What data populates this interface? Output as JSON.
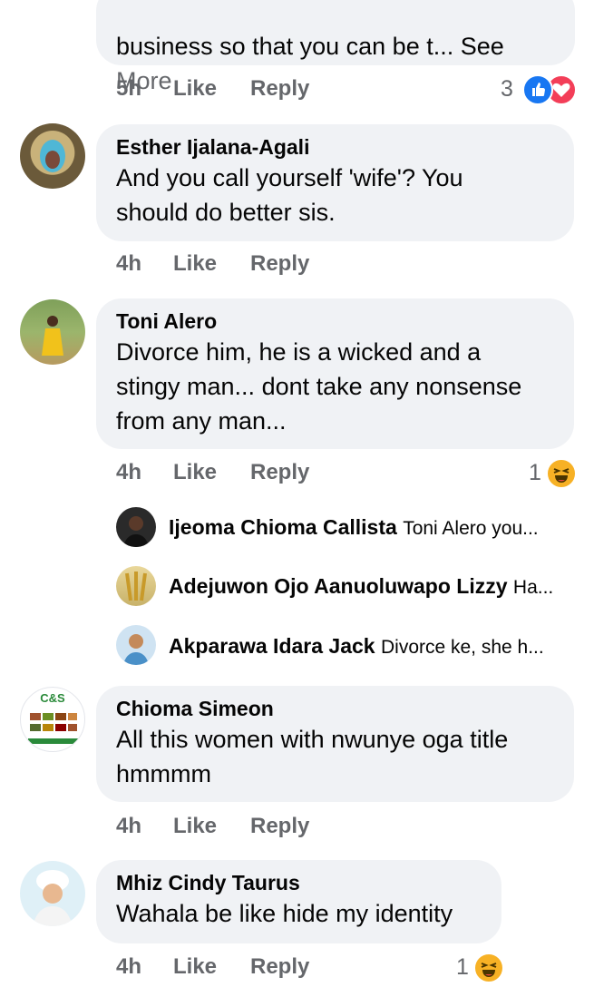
{
  "comments": [
    {
      "text_top": "business so that you can be t... See",
      "text_more": "More",
      "time": "5h",
      "like": "Like",
      "reply": "Reply",
      "reactions": "3"
    },
    {
      "author": "Esther Ijalana-Agali",
      "text": "And you call yourself 'wife'? You\nshould do better sis.",
      "time": "4h",
      "like": "Like",
      "reply": "Reply"
    },
    {
      "author": "Toni Alero",
      "text": "Divorce him, he is a wicked and a\nstingy man... dont take any nonsense\nfrom any man...",
      "time": "4h",
      "like": "Like",
      "reply": "Reply",
      "reactions": "1"
    },
    {
      "author": "Chioma Simeon",
      "avatar_text": "C&S",
      "text": "All this women with nwunye oga title\nhmmmm",
      "time": "4h",
      "like": "Like",
      "reply": "Reply"
    },
    {
      "author": "Mhiz Cindy Taurus",
      "text": "Wahala be like hide my identity",
      "time": "4h",
      "like": "Like",
      "reply": "Reply",
      "reactions": "1"
    }
  ],
  "replies": [
    {
      "name": "Ijeoma Chioma Callista",
      "text": "Toni Alero you..."
    },
    {
      "name": "Adejuwon Ojo Aanuoluwapo Lizzy",
      "text": "Ha..."
    },
    {
      "name": "Akparawa Idara Jack",
      "text": "Divorce ke, she h..."
    }
  ],
  "colors": {
    "bubble": "#f0f2f5",
    "meta": "#65676b",
    "like_blue": "#1877f2",
    "love_red": "#f33e58",
    "haha_yellow": "#f7b125"
  },
  "icons": [
    "like-reaction-icon",
    "love-reaction-icon",
    "haha-reaction-icon"
  ]
}
